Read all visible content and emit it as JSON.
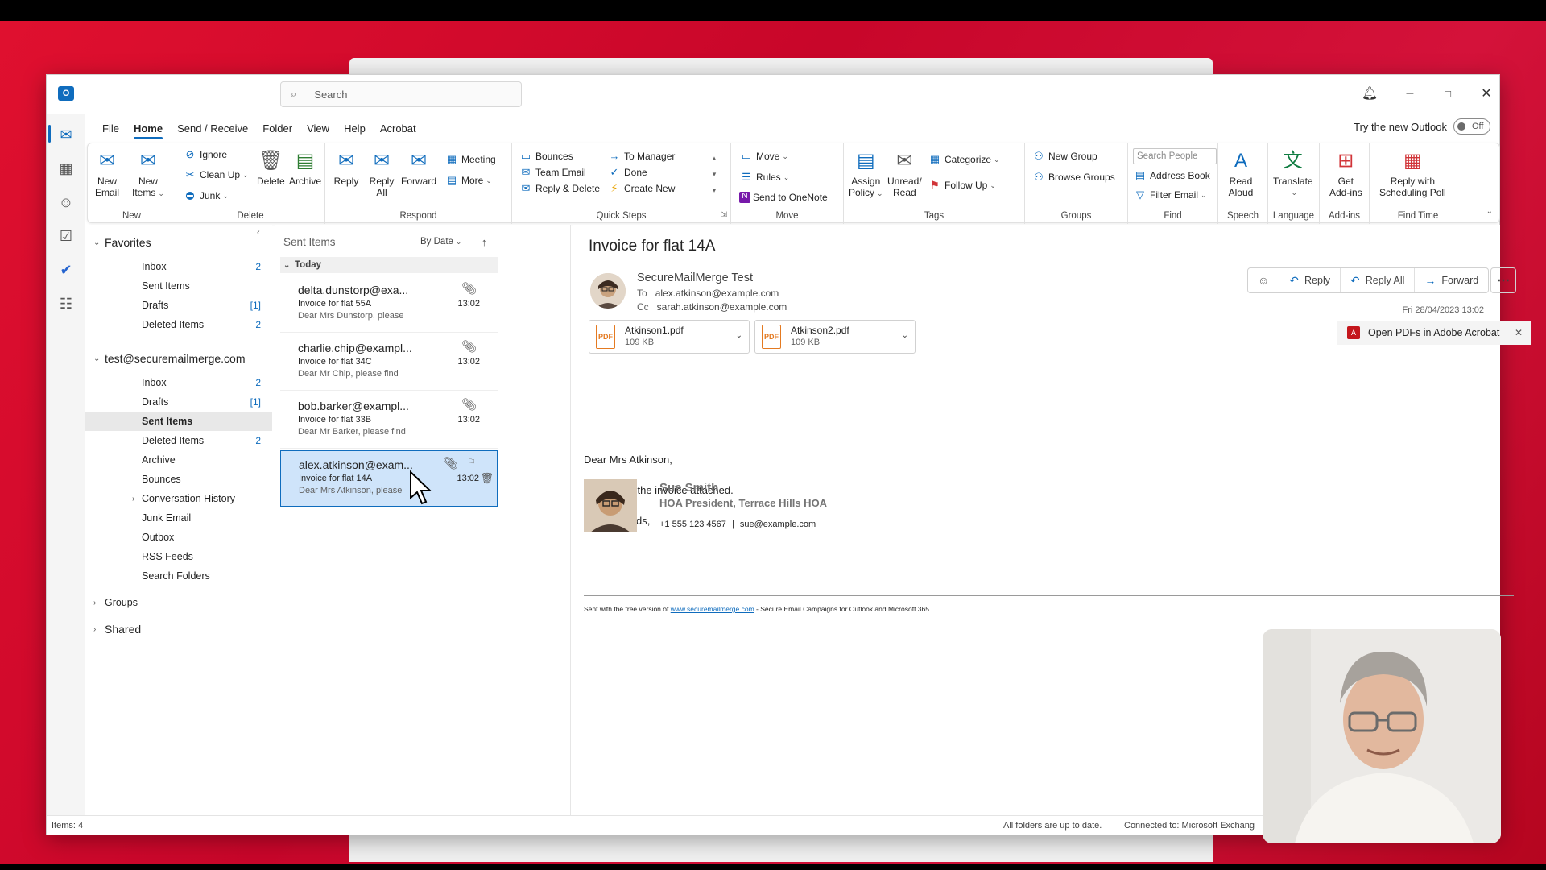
{
  "window": {
    "search_placeholder": "Search",
    "try_new_label": "Try the new Outlook",
    "toggle_label": "Off"
  },
  "menu": [
    "File",
    "Home",
    "Send / Receive",
    "Folder",
    "View",
    "Help",
    "Acrobat"
  ],
  "ribbon": {
    "new": {
      "label": "New",
      "new_email": [
        "New",
        "Email"
      ],
      "new_items": [
        "New",
        "Items"
      ]
    },
    "delete": {
      "label": "Delete",
      "ignore": "Ignore",
      "clean_up": "Clean Up",
      "junk": "Junk",
      "delete": "Delete",
      "archive": "Archive"
    },
    "respond": {
      "label": "Respond",
      "reply": "Reply",
      "reply_all": [
        "Reply",
        "All"
      ],
      "forward": "Forward",
      "meeting": "Meeting",
      "more": "More"
    },
    "quick_steps": {
      "label": "Quick Steps",
      "items": [
        "Bounces",
        "To Manager",
        "Team Email",
        "Done",
        "Reply & Delete",
        "Create New"
      ]
    },
    "move": {
      "label": "Move",
      "move": "Move",
      "rules": "Rules",
      "onenote": "Send to OneNote"
    },
    "tags": {
      "label": "Tags",
      "assign": [
        "Assign",
        "Policy"
      ],
      "unread": [
        "Unread/",
        "Read"
      ],
      "categorize": "Categorize",
      "follow_up": "Follow Up"
    },
    "groups": {
      "label": "Groups",
      "new_group": "New Group",
      "browse": "Browse Groups"
    },
    "find": {
      "label": "Find",
      "search_people": "Search People",
      "address_book": "Address Book",
      "filter_email": "Filter Email"
    },
    "speech": {
      "label": "Speech",
      "read_aloud": [
        "Read",
        "Aloud"
      ]
    },
    "language": {
      "label": "Language",
      "translate": "Translate"
    },
    "addins": {
      "label": "Add-ins",
      "get": [
        "Get",
        "Add-ins"
      ]
    },
    "findtime": {
      "label": "Find Time",
      "reply_poll": [
        "Reply with",
        "Scheduling Poll"
      ]
    }
  },
  "folders": {
    "favorites_label": "Favorites",
    "favorites": [
      {
        "name": "Inbox",
        "count": "2"
      },
      {
        "name": "Sent Items",
        "count": ""
      },
      {
        "name": "Drafts",
        "count": "[1]"
      },
      {
        "name": "Deleted Items",
        "count": "2"
      }
    ],
    "account_label": "test@securemailmerge.com",
    "account": [
      {
        "name": "Inbox",
        "count": "2"
      },
      {
        "name": "Drafts",
        "count": "[1]"
      },
      {
        "name": "Sent Items",
        "count": ""
      },
      {
        "name": "Deleted Items",
        "count": "2"
      },
      {
        "name": "Archive",
        "count": ""
      },
      {
        "name": "Bounces",
        "count": ""
      },
      {
        "name": "Conversation History",
        "count": ""
      },
      {
        "name": "Junk Email",
        "count": ""
      },
      {
        "name": "Outbox",
        "count": ""
      },
      {
        "name": "RSS Feeds",
        "count": ""
      },
      {
        "name": "Search Folders",
        "count": ""
      }
    ],
    "groups_label": "Groups",
    "shared_label": "Shared"
  },
  "list": {
    "title": "Sent Items",
    "sort": "By Date",
    "group": "Today",
    "messages": [
      {
        "from": "delta.dunstorp@exa...",
        "subject": "Invoice for flat 55A",
        "preview": "Dear Mrs Dunstorp,  please",
        "time": "13:02"
      },
      {
        "from": "charlie.chip@exampl...",
        "subject": "Invoice for flat 34C",
        "preview": "Dear Mr Chip,  please find",
        "time": "13:02"
      },
      {
        "from": "bob.barker@exampl...",
        "subject": "Invoice for flat 33B",
        "preview": "Dear Mr Barker,  please find",
        "time": "13:02"
      },
      {
        "from": "alex.atkinson@exam...",
        "subject": "Invoice for flat 14A",
        "preview": "Dear Mrs Atkinson,  please",
        "time": "13:02"
      }
    ]
  },
  "email": {
    "subject": "Invoice for flat 14A",
    "sender": "SecureMailMerge Test",
    "to_label": "To",
    "to": "alex.atkinson@example.com",
    "cc_label": "Cc",
    "cc": "sarah.atkinson@example.com",
    "datetime": "Fri 28/04/2023 13:02",
    "actions": {
      "reply": "Reply",
      "reply_all": "Reply All",
      "forward": "Forward"
    },
    "attachments": [
      {
        "name": "Atkinson1.pdf",
        "size": "109 KB"
      },
      {
        "name": "Atkinson2.pdf",
        "size": "109 KB"
      }
    ],
    "acrobat_banner": "Open PDFs in Adobe Acrobat",
    "body": [
      "Dear Mrs Atkinson,",
      "please find the invoice attached.",
      "Kind Regards,"
    ],
    "signature": {
      "name": "Sue Smith",
      "title": "HOA President, Terrace Hills HOA",
      "phone": "+1 555 123 4567",
      "sep": "|",
      "email": "sue@example.com"
    },
    "footer": {
      "pre": "Sent with the free version of ",
      "link": "www.securemailmerge.com",
      "post": " - Secure Email Campaigns for Outlook and Microsoft 365"
    }
  },
  "status": {
    "items": "Items: 4",
    "folders": "All folders are up to date.",
    "connected": "Connected to: Microsoft Exchang"
  }
}
